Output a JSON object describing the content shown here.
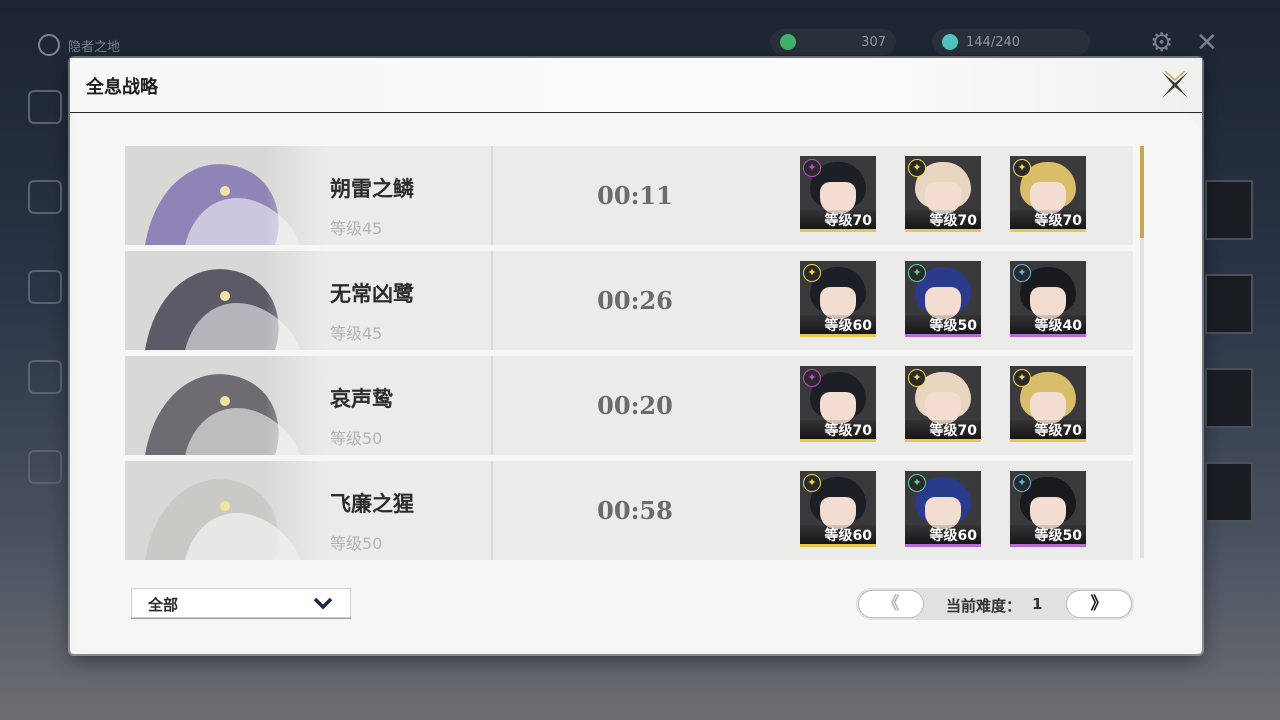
{
  "background": {
    "title": "隐者之地",
    "resources": [
      {
        "name": "coin-resource",
        "value": "307",
        "color": "#3fb36b"
      },
      {
        "name": "stamina-resource",
        "value": "144/240",
        "color": "#4ec3c1"
      }
    ]
  },
  "panel": {
    "title": "全息战略",
    "close_icon": "close-x-icon"
  },
  "bosses": [
    {
      "name": "朔雷之鳞",
      "level": "等级45",
      "time": "00:11",
      "art_color": "#8f83b8",
      "team": [
        {
          "level": "等级70",
          "element": "electro",
          "element_color": "#c24bc2",
          "hair": "#1d1f26",
          "bar": "#e6c84a"
        },
        {
          "level": "等级70",
          "element": "spectro",
          "element_color": "#f0d44a",
          "hair": "#e8d6c0",
          "bar": "#e6c84a"
        },
        {
          "level": "等级70",
          "element": "spectro",
          "element_color": "#f0d44a",
          "hair": "#d9bd6a",
          "bar": "#e6c84a"
        }
      ]
    },
    {
      "name": "无常凶鹭",
      "level": "等级45",
      "time": "00:26",
      "art_color": "#5c5a66",
      "team": [
        {
          "level": "等级60",
          "element": "spectro",
          "element_color": "#f0d44a",
          "hair": "#1d1f26",
          "bar": "#e6c84a"
        },
        {
          "level": "等级50",
          "element": "aero",
          "element_color": "#5cd39a",
          "hair": "#2a3a8c",
          "bar": "#b56ad6"
        },
        {
          "level": "等级40",
          "element": "glacio",
          "element_color": "#55b8e6",
          "hair": "#1a1a1e",
          "bar": "#b56ad6"
        }
      ]
    },
    {
      "name": "哀声鸷",
      "level": "等级50",
      "time": "00:20",
      "art_color": "#6e6c72",
      "team": [
        {
          "level": "等级70",
          "element": "electro",
          "element_color": "#c24bc2",
          "hair": "#1d1f26",
          "bar": "#e6c84a"
        },
        {
          "level": "等级70",
          "element": "spectro",
          "element_color": "#f0d44a",
          "hair": "#e8d6c0",
          "bar": "#e6c84a"
        },
        {
          "level": "等级70",
          "element": "spectro",
          "element_color": "#f0d44a",
          "hair": "#d9bd6a",
          "bar": "#e6c84a"
        }
      ]
    },
    {
      "name": "飞廉之猩",
      "level": "等级50",
      "time": "00:58",
      "art_color": "#c9c9c6",
      "team": [
        {
          "level": "等级60",
          "element": "spectro",
          "element_color": "#f0d44a",
          "hair": "#1d1f26",
          "bar": "#e6c84a"
        },
        {
          "level": "等级60",
          "element": "aero",
          "element_color": "#5cd39a",
          "hair": "#2a3a8c",
          "bar": "#b56ad6"
        },
        {
          "level": "等级50",
          "element": "glacio",
          "element_color": "#55b8e6",
          "hair": "#1a1a1e",
          "bar": "#b56ad6"
        }
      ]
    }
  ],
  "filter": {
    "selected": "全部",
    "icon": "chevron-down-icon"
  },
  "pager": {
    "prev": "《",
    "next": "》",
    "label": "当前难度：",
    "value": "1"
  }
}
